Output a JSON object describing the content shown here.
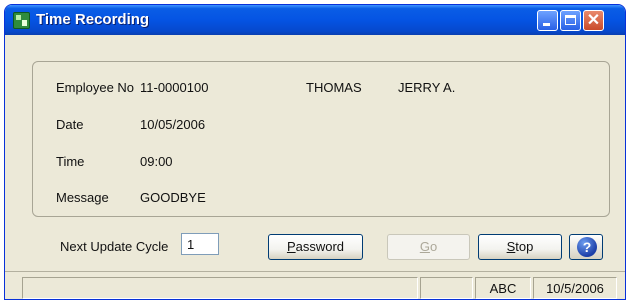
{
  "window": {
    "title": "Time Recording",
    "app_icon": "time-recording-app-icon",
    "controls": {
      "minimize": "minimize-icon",
      "maximize": "maximize-icon",
      "close": "close-icon"
    }
  },
  "info": {
    "employee_no_label": "Employee No",
    "employee_no": "11-0000100",
    "last_name": "THOMAS",
    "first_name": "JERRY A.",
    "date_label": "Date",
    "date": "10/05/2006",
    "time_label": "Time",
    "time": "09:00",
    "message_label": "Message",
    "message": "GOODBYE"
  },
  "footer": {
    "next_update_label": "Next Update Cycle",
    "next_update_value": "1",
    "password_underline": "P",
    "password_rest": "assword",
    "go_underline": "G",
    "go_rest": "o",
    "stop_underline": "S",
    "stop_rest": "top",
    "help_icon": "help-icon"
  },
  "statusbar": {
    "panel1": "",
    "panel2": "",
    "panel3": "ABC",
    "panel4": "10/5/2006"
  }
}
